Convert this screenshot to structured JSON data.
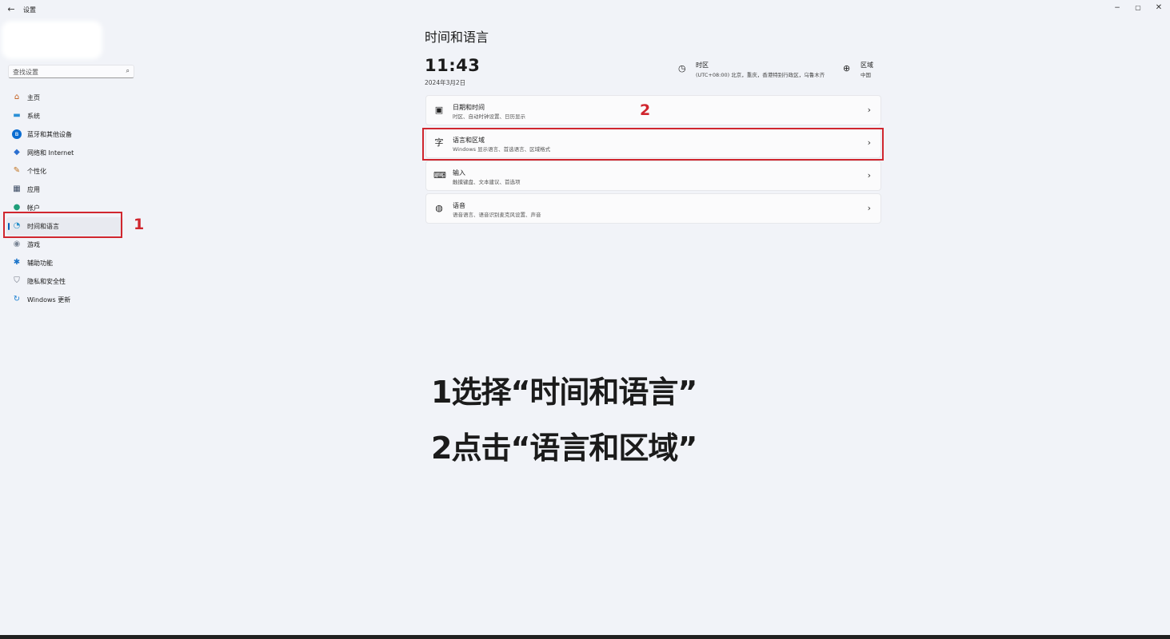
{
  "window": {
    "back_icon": "←",
    "title": "设置",
    "min_icon": "−",
    "max_icon": "▢",
    "close_icon": "✕"
  },
  "search": {
    "placeholder": "查找设置",
    "icon": "⌕"
  },
  "sidebar": {
    "items": [
      {
        "label": "主页",
        "icon": "⌂",
        "icon_name": "home-icon",
        "icon_color": "#c25b17"
      },
      {
        "label": "系统",
        "icon": "▬",
        "icon_name": "system-icon",
        "icon_color": "#2a8fd6"
      },
      {
        "label": "蓝牙和其他设备",
        "icon": "ʙ",
        "icon_name": "bluetooth-icon",
        "icon_color": "#0a6cd1"
      },
      {
        "label": "网络和 Internet",
        "icon": "◆",
        "icon_name": "network-icon",
        "icon_color": "#2b6fd0"
      },
      {
        "label": "个性化",
        "icon": "✎",
        "icon_name": "personalization-icon",
        "icon_color": "#c0701a"
      },
      {
        "label": "应用",
        "icon": "▦",
        "icon_name": "apps-icon",
        "icon_color": "#3c4b63"
      },
      {
        "label": "帐户",
        "icon": "●",
        "icon_name": "accounts-icon",
        "icon_color": "#1f9e7a"
      },
      {
        "label": "时间和语言",
        "icon": "◔",
        "icon_name": "time-language-icon",
        "icon_color": "#2890c8",
        "active": true
      },
      {
        "label": "游戏",
        "icon": "◉",
        "icon_name": "gaming-icon",
        "icon_color": "#7a8595"
      },
      {
        "label": "辅助功能",
        "icon": "✱",
        "icon_name": "accessibility-icon",
        "icon_color": "#1a74c9"
      },
      {
        "label": "隐私和安全性",
        "icon": "⛉",
        "icon_name": "privacy-shield-icon",
        "icon_color": "#6d7380"
      },
      {
        "label": "Windows 更新",
        "icon": "↻",
        "icon_name": "windows-update-icon",
        "icon_color": "#1a7fd1"
      }
    ]
  },
  "main": {
    "title": "时间和语言",
    "clock": "11:43",
    "date": "2024年3月2日",
    "timezone": {
      "icon": "◷",
      "title": "时区",
      "value": "(UTC+08:00) 北京，重庆，香港特别行政区，乌鲁木齐"
    },
    "region": {
      "icon": "⊕",
      "title": "区域",
      "value": "中国"
    },
    "cards": [
      {
        "title": "日期和时间",
        "desc": "时区、自动时钟设置、日历显示",
        "icon": "▣",
        "chevron": "›"
      },
      {
        "title": "语言和区域",
        "desc": "Windows 显示语言、首选语言、区域格式",
        "icon": "字",
        "chevron": "›"
      },
      {
        "title": "输入",
        "desc": "触摸键盘、文本建议、首选项",
        "icon": "⌨",
        "chevron": "›"
      },
      {
        "title": "语音",
        "desc": "语音语言、语音识别麦克风设置、声音",
        "icon": "◍",
        "chevron": "›"
      }
    ]
  },
  "annotations": {
    "step1_number": "1",
    "step2_number": "2",
    "instruction1": "1选择“时间和语言”",
    "instruction2": "2点击“语言和区域”",
    "color": "#d0262e"
  }
}
